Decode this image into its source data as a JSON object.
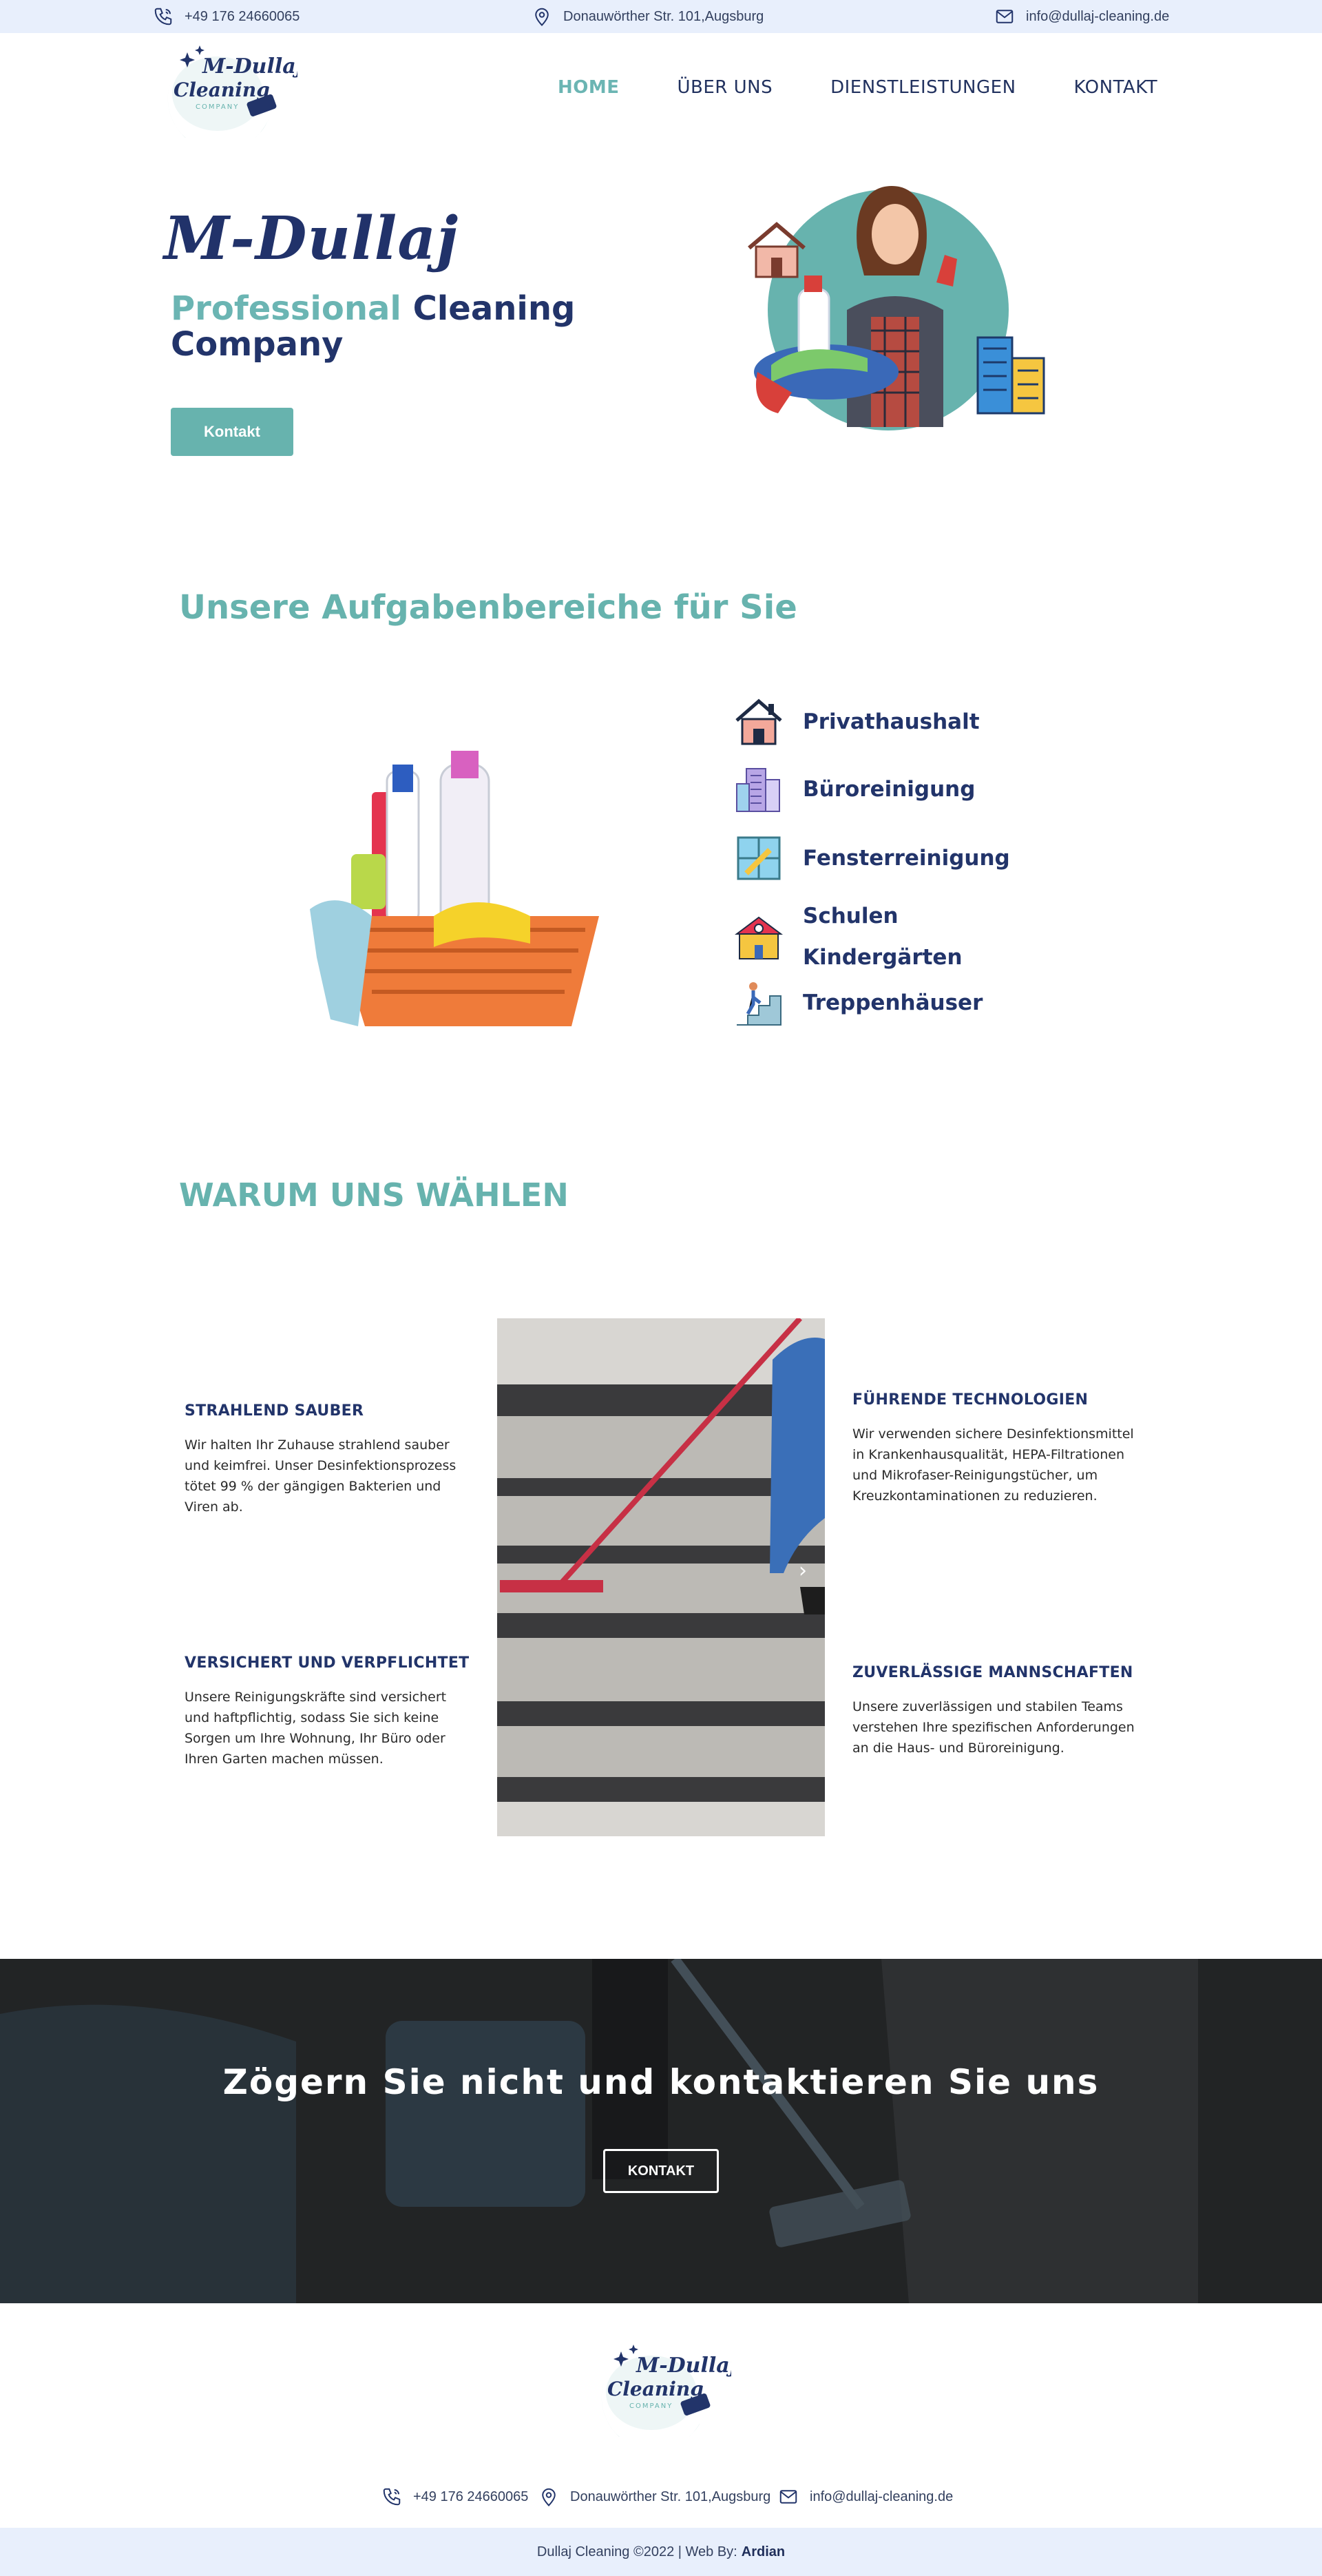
{
  "topbar": {
    "phone": "+49 176 24660065",
    "address": "Donauwörther Str. 101,Augsburg",
    "email": "info@dullaj-cleaning.de"
  },
  "logo": {
    "script": "M-Dullaj",
    "word": "Cleaning",
    "tag": "COMPANY"
  },
  "nav": {
    "items": [
      {
        "label": "HOME",
        "active": true
      },
      {
        "label": "ÜBER UNS",
        "active": false
      },
      {
        "label": "DIENSTLEISTUNGEN",
        "active": false
      },
      {
        "label": "KONTAKT",
        "active": false
      }
    ]
  },
  "hero": {
    "script_title": "M-Dullaj",
    "subtitle_accent": "Professional",
    "subtitle_rest_1": "Cleaning",
    "subtitle_rest_2": "Company",
    "button": "Kontakt"
  },
  "services": {
    "heading": "Unsere Aufgabenbereiche für Sie",
    "items": [
      {
        "label": "Privathaushalt",
        "icon": "house-icon"
      },
      {
        "label": "Büroreinigung",
        "icon": "office-building-icon"
      },
      {
        "label": "Fensterreinigung",
        "icon": "window-cleaning-icon"
      },
      {
        "label": "Schulen",
        "label2": "Kindergärten",
        "icon": "school-icon"
      },
      {
        "label": "Treppenhäuser",
        "icon": "stairs-icon"
      }
    ]
  },
  "why": {
    "heading": "WARUM UNS WÄHLEN",
    "features": [
      {
        "title": "STRAHLEND SAUBER",
        "text": "Wir halten Ihr Zuhause strahlend sauber und keimfrei. Unser Desinfektionsprozess tötet 99 % der gängigen Bakterien und Viren ab."
      },
      {
        "title": "FÜHRENDE TECHNOLOGIEN",
        "text": "Wir verwenden sichere Desinfektionsmittel in Krankenhausqualität, HEPA-Filtrationen und Mikrofaser-Reinigungstücher, um Kreuzkontaminationen zu reduzieren."
      },
      {
        "title": "VERSICHERT UND VERPFLICHTET",
        "text": "Unsere Reinigungskräfte sind versichert und haftpflichtig, sodass Sie sich keine Sorgen um Ihre Wohnung, Ihr Büro oder Ihren Garten machen müssen."
      },
      {
        "title": "ZUVERLÄSSIGE MANNSCHAFTEN",
        "text": "Unsere zuverlässigen und stabilen Teams verstehen Ihre spezifischen Anforderungen an die Haus- und Büroreinigung."
      }
    ]
  },
  "cta": {
    "title": "Zögern Sie nicht und kontaktieren Sie uns",
    "button": "KONTAKT"
  },
  "footer": {
    "phone": "+49 176 24660065",
    "address": "Donauwörther Str. 101,Augsburg",
    "email": "info@dullaj-cleaning.de",
    "copyright": "Dullaj Cleaning ©2022 | Web By:",
    "author": "Ardian"
  },
  "colors": {
    "teal": "#67b3ae",
    "navy": "#22346a",
    "topbar": "#e8effc"
  }
}
